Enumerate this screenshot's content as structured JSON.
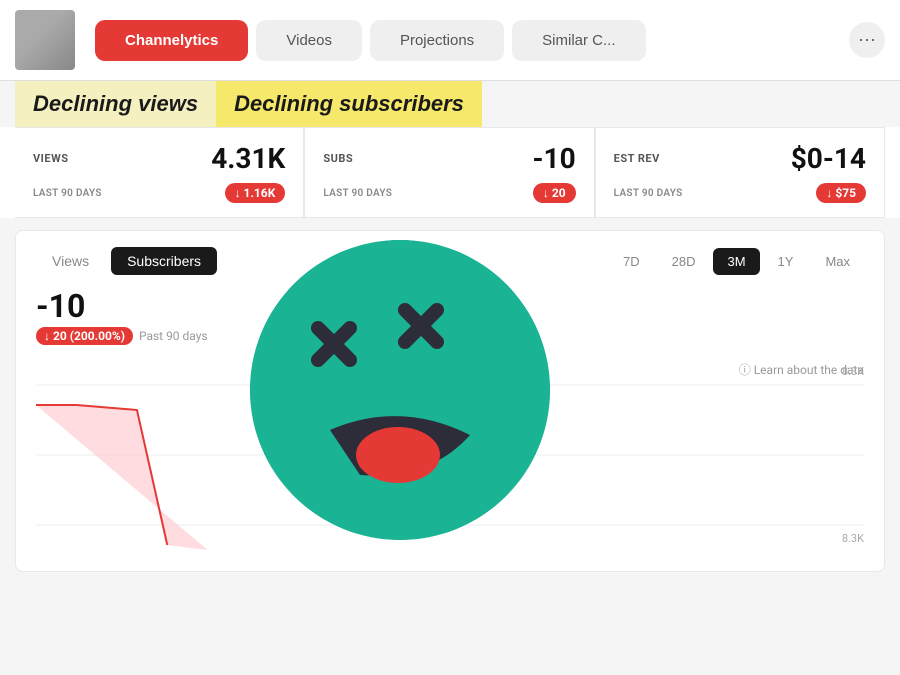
{
  "nav": {
    "tabs": [
      {
        "label": "Channelytics",
        "active": true
      },
      {
        "label": "Videos",
        "active": false
      },
      {
        "label": "Projections",
        "active": false
      },
      {
        "label": "Similar C...",
        "active": false
      }
    ],
    "more_icon": "⋯"
  },
  "alerts": {
    "views_text": "Declining views",
    "subs_text": "Declining subscribers"
  },
  "stats": [
    {
      "label": "VIEWS",
      "value": "4.31K",
      "period": "LAST 90 DAYS",
      "badge": "↓ 1.16K"
    },
    {
      "label": "SUBS",
      "value": "-10",
      "period": "LAST 90 DAYS",
      "badge": "↓ 20"
    },
    {
      "label": "EST REV",
      "value": "$0-14",
      "period": "LAST 90 DAYS",
      "badge": "↓ $75"
    }
  ],
  "chart": {
    "view_tab": "Views",
    "subs_tab": "Subscribers",
    "active_tab": "Subscribers",
    "time_tabs": [
      "7D",
      "28D",
      "3M",
      "1Y",
      "Max"
    ],
    "active_time": "3M",
    "metric_value": "-10",
    "metric_badge": "20 (200.00%)",
    "metric_period": "Past 90 days",
    "learn_text": "ⓘ Learn about the data",
    "y_labels": [
      "8.3K",
      "8.3K"
    ]
  }
}
